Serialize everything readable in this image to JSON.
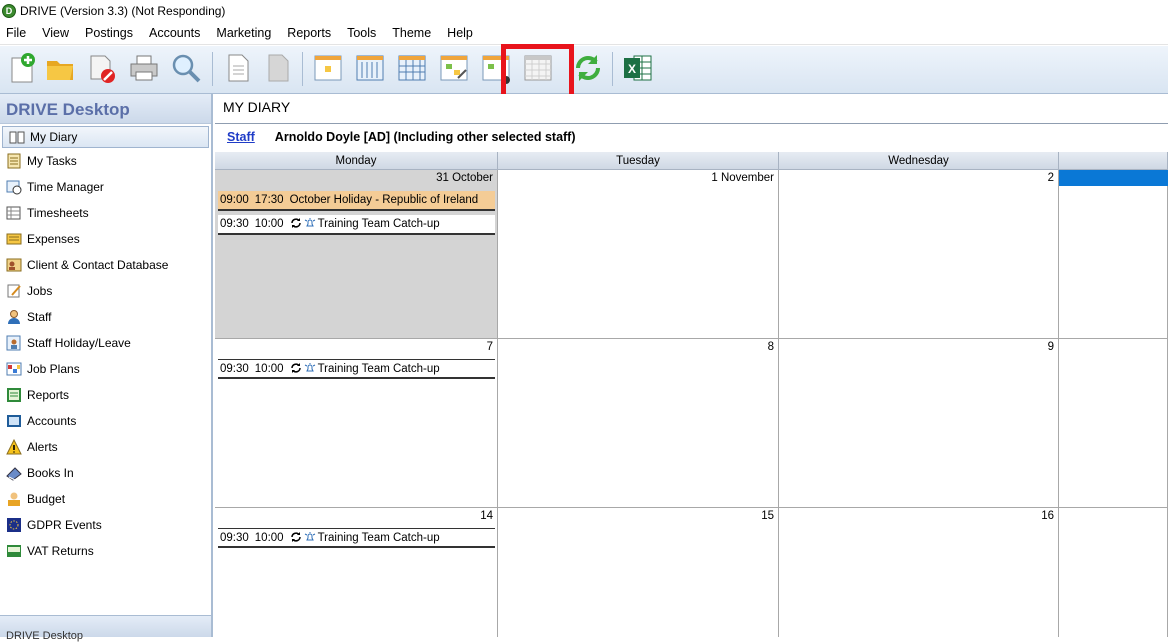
{
  "window": {
    "title": "DRIVE (Version 3.3) (Not Responding)",
    "app_icon_letter": "D"
  },
  "menu": [
    "File",
    "View",
    "Postings",
    "Accounts",
    "Marketing",
    "Reports",
    "Tools",
    "Theme",
    "Help"
  ],
  "toolbar": {
    "buttons": [
      "new-icon",
      "open-folder-icon",
      "delete-icon",
      "print-icon",
      "search-icon",
      "document-icon",
      "document-gray-icon",
      "calendar-day-icon",
      "calendar-week-icon",
      "calendar-month-icon",
      "calendar-edit-icon",
      "calendar-plan-icon",
      "calendar-blank-icon",
      "refresh-icon",
      "excel-icon"
    ],
    "highlighted": "calendar-blank-icon",
    "highlight_color": "#e8141c"
  },
  "sidebar": {
    "title": "DRIVE Desktop",
    "items": [
      {
        "label": "My Diary",
        "icon": "diary-icon",
        "active": true
      },
      {
        "label": "My Tasks",
        "icon": "tasks-icon"
      },
      {
        "label": "Time Manager",
        "icon": "time-manager-icon"
      },
      {
        "label": "Timesheets",
        "icon": "timesheets-icon"
      },
      {
        "label": "Expenses",
        "icon": "expenses-icon"
      },
      {
        "label": "Client & Contact Database",
        "icon": "contacts-icon"
      },
      {
        "label": "Jobs",
        "icon": "jobs-icon"
      },
      {
        "label": "Staff",
        "icon": "staff-icon"
      },
      {
        "label": "Staff Holiday/Leave",
        "icon": "holiday-icon"
      },
      {
        "label": "Job Plans",
        "icon": "job-plans-icon"
      },
      {
        "label": "Reports",
        "icon": "reports-icon"
      },
      {
        "label": "Accounts",
        "icon": "accounts-icon"
      },
      {
        "label": "Alerts",
        "icon": "alert-icon"
      },
      {
        "label": "Books In",
        "icon": "books-icon"
      },
      {
        "label": "Budget",
        "icon": "budget-icon"
      },
      {
        "label": "GDPR Events",
        "icon": "gdpr-icon"
      },
      {
        "label": "VAT Returns",
        "icon": "vat-icon"
      }
    ],
    "footer": "DRIVE Desktop"
  },
  "main": {
    "title": "MY DIARY",
    "staff_link": "Staff",
    "staff_name": "Arnoldo Doyle [AD]  (Including other selected staff)",
    "days": [
      "Monday",
      "Tuesday",
      "Wednesday"
    ],
    "weeks": [
      {
        "dates": [
          "31 October",
          "1 November",
          "2"
        ],
        "events": [
          {
            "start": "09:00",
            "end": "17:30",
            "title": "October Holiday - Republic of Ireland",
            "type": "holiday"
          },
          {
            "start": "09:30",
            "end": "10:00",
            "title": "Training Team Catch-up",
            "type": "recurring"
          }
        ]
      },
      {
        "dates": [
          "7",
          "8",
          "9"
        ],
        "events": [
          {
            "start": "09:30",
            "end": "10:00",
            "title": "Training Team Catch-up",
            "type": "recurring"
          }
        ]
      },
      {
        "dates": [
          "14",
          "15",
          "16"
        ],
        "events": [
          {
            "start": "09:30",
            "end": "10:00",
            "title": "Training Team Catch-up",
            "type": "recurring"
          }
        ]
      }
    ]
  }
}
